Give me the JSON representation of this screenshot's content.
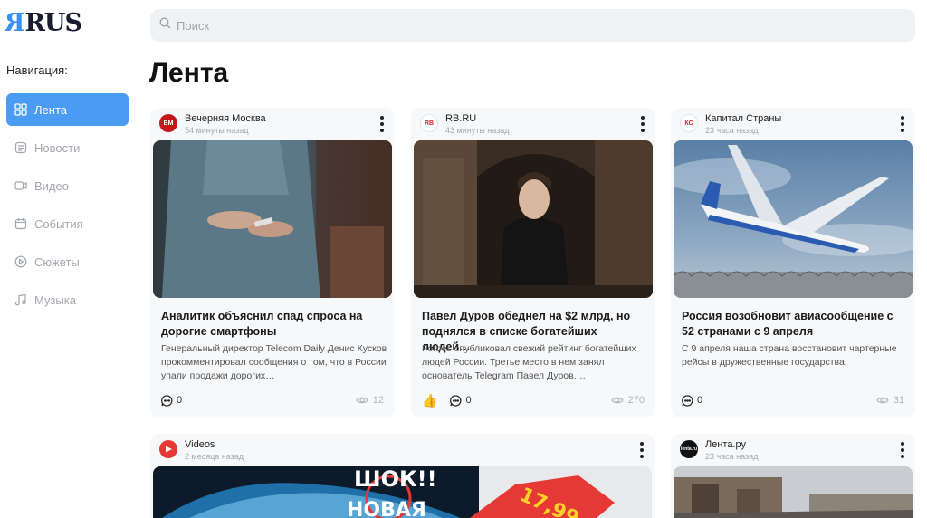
{
  "logo": {
    "text": "RUS",
    "mirrored": "R"
  },
  "nav": {
    "title": "Навигация:",
    "items": [
      {
        "label": "Лента",
        "icon": "grid-icon",
        "active": true
      },
      {
        "label": "Новости",
        "icon": "newspaper-icon"
      },
      {
        "label": "Видео",
        "icon": "video-icon"
      },
      {
        "label": "События",
        "icon": "calendar-icon"
      },
      {
        "label": "Сюжеты",
        "icon": "play-circle-icon"
      },
      {
        "label": "Музыка",
        "icon": "music-note-icon"
      }
    ]
  },
  "search": {
    "placeholder": "Поиск",
    "value": ""
  },
  "page_title": "Лента",
  "cards": [
    {
      "source": "Вечерняя Москва",
      "logo_text": "ВМ",
      "time": "54 минуты назад",
      "title": "Аналитик объяснил спад спроса на дорогие смартфоны",
      "desc": "Генеральный директор Telecom Daily Денис Кусков прокомментировал сообщения о том, что в России упали продажи дорогих…",
      "comments": "0",
      "views": "12",
      "liked": false
    },
    {
      "source": "RB.RU",
      "logo_text": "RB",
      "time": "43 минуты назад",
      "title": "Павел Дуров обеднел на $2 млрд, но поднялся в списке богатейших людей…",
      "desc": "Forbes опубликовал свежий рейтинг богатейших людей России. Третье место в нем занял основатель Telegram Павел Дуров.…",
      "comments": "0",
      "views": "270",
      "liked": true,
      "like_emoji": "👍"
    },
    {
      "source": "Капитал Страны",
      "logo_text": "КС",
      "time": "23 часа назад",
      "title": "Россия возобновит авиасообщение с 52 странами с 9 апреля",
      "desc": "С 9 апреля наша страна восстановит чартерные рейсы в дружественные государства.",
      "comments": "0",
      "views": "31",
      "liked": false
    },
    {
      "source": "Videos",
      "time": "2 месяца назад",
      "image_text_1": "ШОК!!",
      "image_text_2": "НОВАЯ",
      "image_tag": "17,99"
    },
    {
      "source": "Лента.ру",
      "logo_text": "lenta.ru",
      "time": "23 часа назад"
    }
  ],
  "colors": {
    "accent": "#4a9cf3",
    "card_bg": "#f7f8fa",
    "search_bg": "#f0f1f3"
  }
}
